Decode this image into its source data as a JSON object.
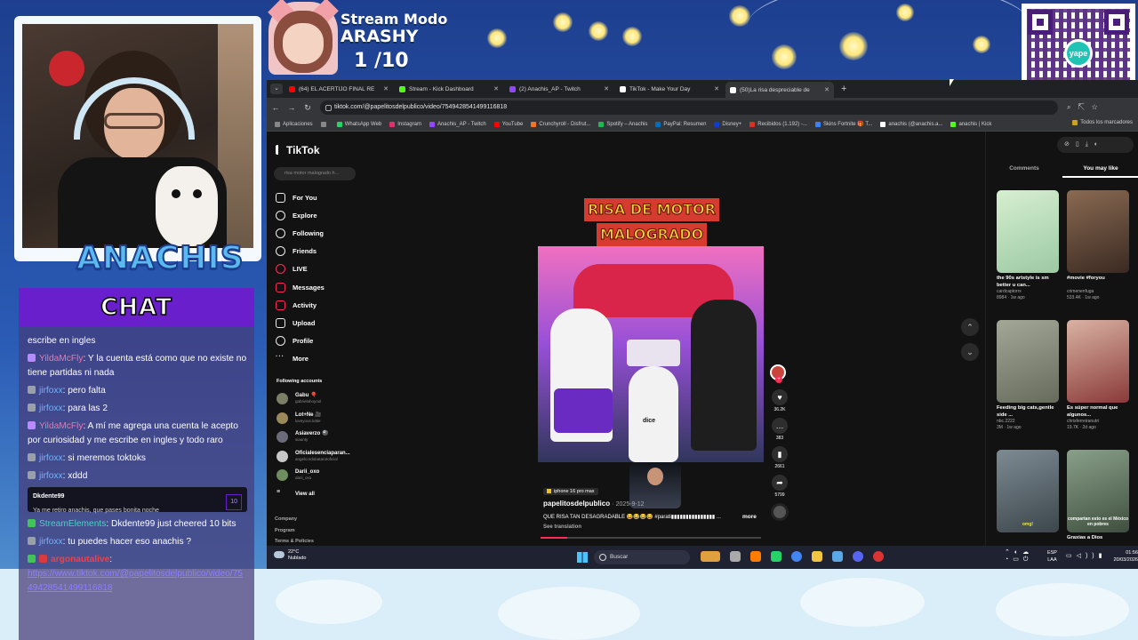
{
  "overlay": {
    "streamer_name": "ANACHIS",
    "chat_title": "CHAT",
    "stream_mode_label": "Stream Modo",
    "stream_mode_name": "ARASHY",
    "stream_mode_count": "1  /10",
    "qr_label": "yape"
  },
  "chat": {
    "messages": [
      {
        "user": "",
        "text": "escribe en ingles"
      },
      {
        "user": "YildaMcFly",
        "text": ": Y la cuenta está como que no existe no tiene partidas ni nada"
      },
      {
        "user": "jirfoxx",
        "text": ": pero falta"
      },
      {
        "user": "jirfoxx",
        "text": ": para las 2"
      },
      {
        "user": "YildaMcFly",
        "text": ": A mí me agrega una cuenta le acepto por curiosidad y me escribe en ingles y todo raro"
      },
      {
        "user": "jirfoxx",
        "text": ": si meremos toktoks"
      },
      {
        "user": "jirfoxx",
        "text": ": xddd"
      }
    ],
    "reply": {
      "user": "Dkdente99",
      "text": "Ya me retiro anachis, que pases bonita noche",
      "count": "10"
    },
    "messages2": [
      {
        "user": "StreamElements",
        "text": ": Dkdente99 just cheered 10 bits"
      },
      {
        "user": "jirfoxx",
        "text": ": tu puedes hacer eso anachis ?"
      },
      {
        "user": "argonautalive",
        "text": ":"
      }
    ],
    "link": "https://www.tiktok.com/@papelitosdelpublico/video/7549428541499116818"
  },
  "browser": {
    "tabs": [
      {
        "title": "(64) EL ACERTIJO FINAL RE",
        "color": "#ff0000"
      },
      {
        "title": "Stream - Kick Dashboard",
        "color": "#53fc18"
      },
      {
        "title": "(2) Anachis_AP - Twitch",
        "color": "#9146ff"
      },
      {
        "title": "TikTok - Make Your Day",
        "color": "#ffffff"
      },
      {
        "title": "(50)La risa despreciable de",
        "color": "#ffffff"
      }
    ],
    "url": "tiktok.com/@papelitosdelpublico/video/7549428541499116818",
    "bookmarks": [
      "Aplicaciones",
      "WhatsApp Web",
      "Instagram",
      "Anachis_AP - Twitch",
      "YouTube",
      "Crunchyroll - Disfrut...",
      "Spotify – Anachis",
      "PayPal: Resumen",
      "Disney+",
      "Recibidos (1.192) -...",
      "Skins Fortnite 🎁 T...",
      "anachis (@anachis.a...",
      "anachis | Kick"
    ],
    "bookmarks_right": "Todos los marcadores"
  },
  "tiktok": {
    "logo": "TikTok",
    "search_placeholder": "risa motor malogrado h...",
    "nav": [
      "For You",
      "Explore",
      "Following",
      "Friends",
      "LIVE",
      "Messages",
      "Activity",
      "Upload",
      "Profile",
      "More"
    ],
    "following_title": "Following accounts",
    "following": [
      {
        "name": "Gabu 🎈",
        "handle": "gabrielahoyool"
      },
      {
        "name": "Lot+Ne 🎥",
        "handle": "loveyous.lottie"
      },
      {
        "name": "Asiaverzo 🎱",
        "handle": "siaunty"
      },
      {
        "name": "Oficialesenciaparan...",
        "handle": "angelcordobatarotoficial"
      },
      {
        "name": "Darii_oxo",
        "handle": "darii_oxo"
      }
    ],
    "view_all": "View all",
    "footer": [
      "Company",
      "Program",
      "Terms & Policies"
    ],
    "video": {
      "title_line1": "RISA DE MOTOR",
      "title_line2": "MALOGRADO",
      "sign_text": "dice",
      "tag": "iphone 16 pro max",
      "author": "papelitosdelpublico",
      "date": "· 2025-9-12",
      "description": "QUE RISA TAN DESAGRADABLE 😂😂😂😂 #parati▮▮▮▮▮▮▮▮▮▮▮▮▮▮▮ ...",
      "more": "more",
      "translation": "See translation",
      "progress": 0.12
    },
    "actions": [
      {
        "icon": "♥",
        "count": "36.2K"
      },
      {
        "icon": "…",
        "count": "383"
      },
      {
        "icon": "▮",
        "count": "2661"
      },
      {
        "icon": "➦",
        "count": "5799"
      }
    ],
    "side_tabs": [
      "Comments",
      "You may like"
    ],
    "recommended": [
      {
        "title": "the 90s artstyle is sm better u can...",
        "author": "cardcaptorrx",
        "meta": "8984 · 1w ago",
        "bg": "#b7dcb0",
        "cap": ""
      },
      {
        "title": "#movie #foryou",
        "author": "crimenenfuga",
        "meta": "533.4K · 1w ago",
        "bg": "#6b4a3a",
        "cap": ""
      },
      {
        "title": "Feeding big cats,gentle side ...",
        "author": "nbc.2222",
        "meta": "3M · 1w ago",
        "bg": "#8a8f80",
        "cap": ""
      },
      {
        "title": "Es súper normal que algunos...",
        "author": "chrisferreiranutri",
        "meta": "19.7K · 2d ago",
        "bg": "#c99a8a",
        "cap": ""
      },
      {
        "title": "",
        "author": "",
        "meta": "",
        "bg": "#5c6a72",
        "cap": "omg!"
      },
      {
        "title": "Graxias a Dios",
        "author": "",
        "meta": "",
        "bg": "#6a7a6a",
        "cap": "compartan esto es el México en pobres"
      }
    ]
  },
  "taskbar": {
    "weather_temp": "22°C",
    "weather_desc": "Nublado",
    "search": "Buscar",
    "lang1": "ESP",
    "lang2": "LAA",
    "time": "01:56",
    "date": "20/03/2026"
  }
}
